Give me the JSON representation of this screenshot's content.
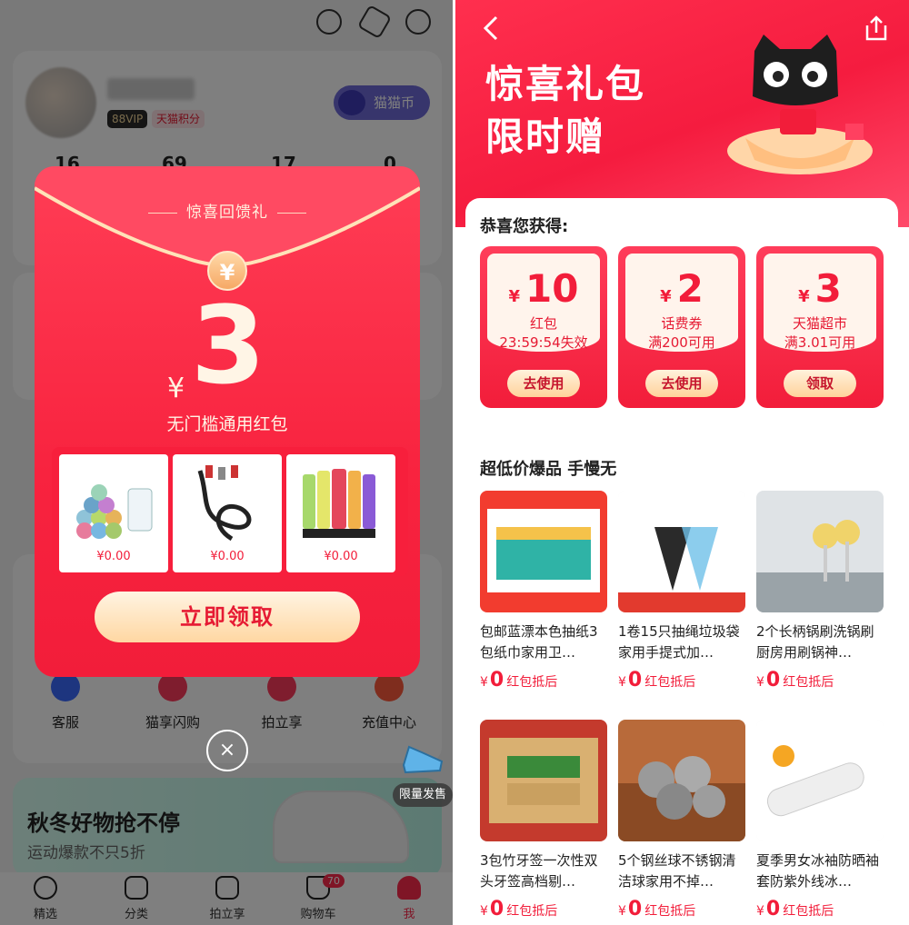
{
  "left": {
    "profile": {
      "vip_badge": "88VIP",
      "points_badge": "天猫积分",
      "coin_button": "猫猫币",
      "stats": [
        "16",
        "69",
        "17",
        "0"
      ]
    },
    "services": [
      "客服",
      "猫享闪购",
      "拍立享",
      "充值中心"
    ],
    "promo": {
      "title": "秋冬好物抢不停",
      "subtitle": "运动爆款不只5折"
    },
    "limited_label": "限量发售",
    "tabbar": {
      "tabs": [
        "精选",
        "分类",
        "拍立享",
        "购物车",
        "我"
      ],
      "cart_badge": "70"
    },
    "modal": {
      "title": "惊喜回馈礼",
      "coin_symbol": "¥",
      "currency": "¥",
      "amount": "3",
      "subtitle": "无门槛通用红包",
      "products": [
        {
          "icon": "trash-bags-image",
          "price": "¥0.00"
        },
        {
          "icon": "charging-cable-image",
          "price": "¥0.00"
        },
        {
          "icon": "hand-cream-image",
          "price": "¥0.00"
        }
      ],
      "claim_button": "立即领取",
      "close_glyph": "×"
    }
  },
  "right": {
    "header": {
      "title_line1": "惊喜礼包",
      "title_line2": "限时赠"
    },
    "congrats": "恭喜您获得:",
    "coupons": [
      {
        "currency": "¥",
        "amount": "10",
        "line1": "红包",
        "line2": "23:59:54失效",
        "button": "去使用"
      },
      {
        "currency": "¥",
        "amount": "2",
        "line1": "话费券",
        "line2": "满200可用",
        "button": "去使用"
      },
      {
        "currency": "¥",
        "amount": "3",
        "line1": "天猫超市",
        "line2": "满3.01可用",
        "button": "领取"
      }
    ],
    "section_title": "超低价爆品 手慢无",
    "products": [
      {
        "name": "包邮蓝漂本色抽纸3包纸巾家用卫…",
        "currency": "¥",
        "price": "0",
        "tag": "红包抵后",
        "icon": "tissue-box-image"
      },
      {
        "name": "1卷15只抽绳垃圾袋家用手提式加…",
        "currency": "¥",
        "price": "0",
        "tag": "红包抵后",
        "icon": "garbage-bag-image"
      },
      {
        "name": "2个长柄锅刷洗锅刷厨房用刷锅神…",
        "currency": "¥",
        "price": "0",
        "tag": "红包抵后",
        "icon": "pot-brush-image"
      },
      {
        "name": "3包竹牙签一次性双头牙签高档剔…",
        "currency": "¥",
        "price": "0",
        "tag": "红包抵后",
        "icon": "toothpick-image"
      },
      {
        "name": "5个钢丝球不锈钢清洁球家用不掉…",
        "currency": "¥",
        "price": "0",
        "tag": "红包抵后",
        "icon": "steel-wool-image"
      },
      {
        "name": "夏季男女冰袖防晒袖套防紫外线冰…",
        "currency": "¥",
        "price": "0",
        "tag": "红包抵后",
        "icon": "ice-sleeve-image"
      }
    ]
  },
  "colors": {
    "brand_red": "#f21d3a",
    "gold": "#ffd7a2",
    "overlay": "rgba(0,0,0,0.5)"
  }
}
